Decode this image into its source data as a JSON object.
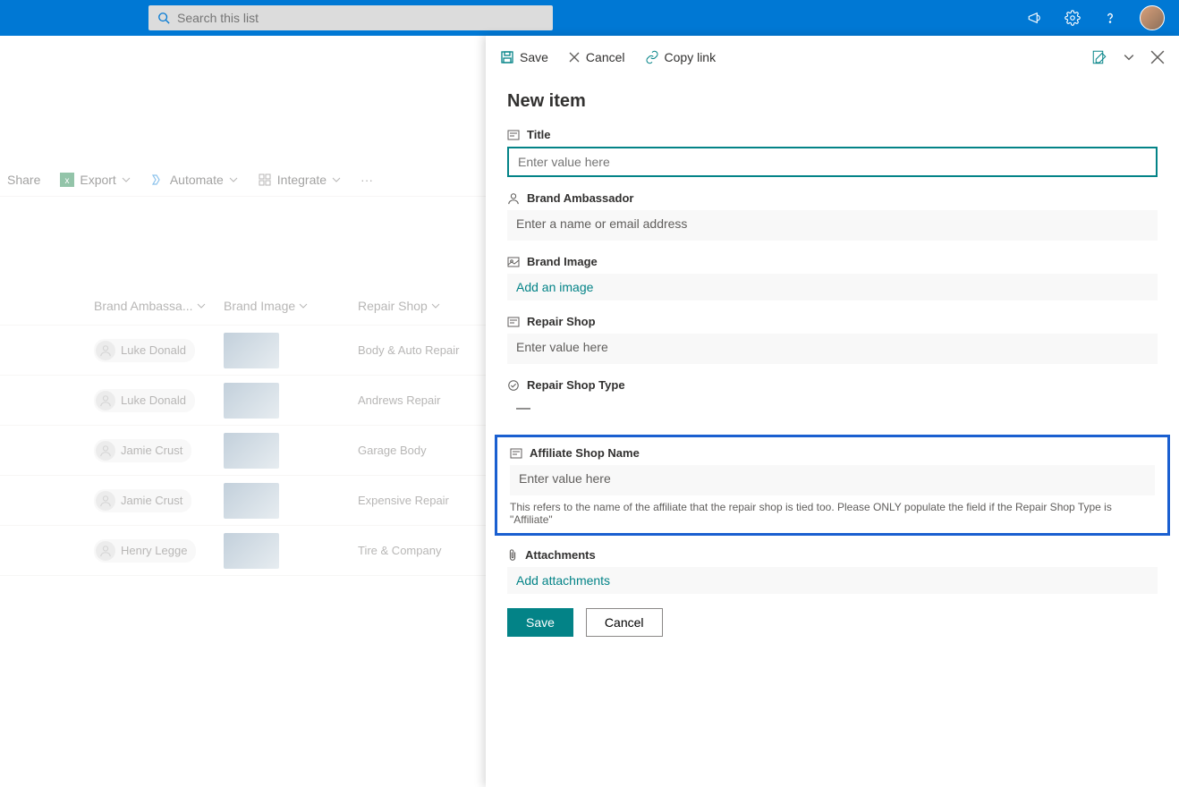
{
  "header": {
    "search_placeholder": "Search this list"
  },
  "commandbar": {
    "share": "Share",
    "export": "Export",
    "automate": "Automate",
    "integrate": "Integrate"
  },
  "columns": {
    "brand_ambassador": "Brand Ambassa...",
    "brand_image": "Brand Image",
    "repair_shop": "Repair Shop"
  },
  "rows": [
    {
      "ambassador": "Luke Donald",
      "repair_shop": "Body & Auto Repair"
    },
    {
      "ambassador": "Luke Donald",
      "repair_shop": "Andrews Repair"
    },
    {
      "ambassador": "Jamie Crust",
      "repair_shop": "Garage Body"
    },
    {
      "ambassador": "Jamie Crust",
      "repair_shop": "Expensive Repair"
    },
    {
      "ambassador": "Henry Legge",
      "repair_shop": "Tire & Company"
    }
  ],
  "panel": {
    "toolbar": {
      "save": "Save",
      "cancel": "Cancel",
      "copy_link": "Copy link"
    },
    "title": "New item",
    "fields": {
      "title_label": "Title",
      "title_placeholder": "Enter value here",
      "brand_ambassador_label": "Brand Ambassador",
      "brand_ambassador_placeholder": "Enter a name or email address",
      "brand_image_label": "Brand Image",
      "brand_image_action": "Add an image",
      "repair_shop_label": "Repair Shop",
      "repair_shop_placeholder": "Enter value here",
      "repair_shop_type_label": "Repair Shop Type",
      "repair_shop_type_value": "—",
      "affiliate_label": "Affiliate Shop Name",
      "affiliate_placeholder": "Enter value here",
      "affiliate_help": "This refers to the name of the affiliate that the repair shop is tied too. Please ONLY populate the field if the Repair Shop Type is \"Affiliate\"",
      "attachments_label": "Attachments",
      "attachments_action": "Add attachments"
    },
    "buttons": {
      "save": "Save",
      "cancel": "Cancel"
    }
  }
}
